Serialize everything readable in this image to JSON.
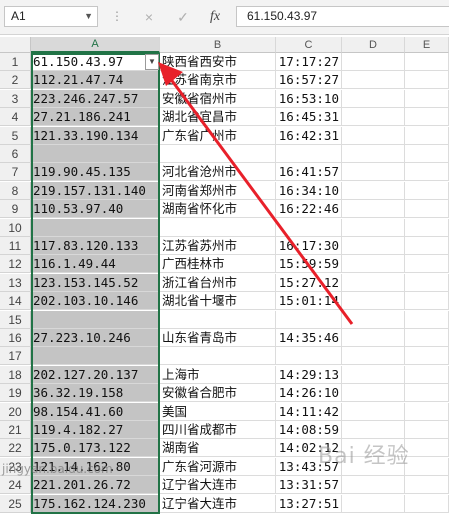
{
  "formula_bar": {
    "name_box": "A1",
    "cancel_icon": "×",
    "enter_icon": "✓",
    "fx_label": "fx",
    "content": "61.150.43.97"
  },
  "columns": [
    "A",
    "B",
    "C",
    "D",
    "E"
  ],
  "selected_column": "A",
  "rows": [
    {
      "n": "1",
      "a": "61.150.43.97",
      "b": "陕西省西安市",
      "c": "17:17:27"
    },
    {
      "n": "2",
      "a": "112.21.47.74",
      "b": "江苏省南京市",
      "c": "16:57:27"
    },
    {
      "n": "3",
      "a": "223.246.247.57",
      "b": "安徽省宿州市",
      "c": "16:53:10"
    },
    {
      "n": "4",
      "a": "27.21.186.241",
      "b": "湖北省宜昌市",
      "c": "16:45:31"
    },
    {
      "n": "5",
      "a": "121.33.190.134",
      "b": "广东省广州市",
      "c": "16:42:31"
    },
    {
      "n": "6",
      "a": "",
      "b": "",
      "c": ""
    },
    {
      "n": "7",
      "a": "119.90.45.135",
      "b": "河北省沧州市",
      "c": "16:41:57"
    },
    {
      "n": "8",
      "a": "219.157.131.140",
      "b": "河南省郑州市",
      "c": "16:34:10"
    },
    {
      "n": "9",
      "a": "110.53.97.40",
      "b": "湖南省怀化市",
      "c": "16:22:46"
    },
    {
      "n": "10",
      "a": "",
      "b": "",
      "c": ""
    },
    {
      "n": "11",
      "a": "117.83.120.133",
      "b": "江苏省苏州市",
      "c": "16:17:30"
    },
    {
      "n": "12",
      "a": "116.1.49.44",
      "b": "广西桂林市",
      "c": "15:59:59"
    },
    {
      "n": "13",
      "a": "123.153.145.52",
      "b": "浙江省台州市",
      "c": "15:27:12"
    },
    {
      "n": "14",
      "a": "202.103.10.146",
      "b": "湖北省十堰市",
      "c": "15:01:14"
    },
    {
      "n": "15",
      "a": "",
      "b": "",
      "c": ""
    },
    {
      "n": "16",
      "a": "27.223.10.246",
      "b": "山东省青岛市",
      "c": "14:35:46"
    },
    {
      "n": "17",
      "a": "",
      "b": "",
      "c": ""
    },
    {
      "n": "18",
      "a": "202.127.20.137",
      "b": "上海市",
      "c": "14:29:13"
    },
    {
      "n": "19",
      "a": "36.32.19.158",
      "b": "安徽省合肥市",
      "c": "14:26:10"
    },
    {
      "n": "20",
      "a": "98.154.41.60",
      "b": "美国",
      "c": "14:11:42"
    },
    {
      "n": "21",
      "a": "119.4.182.27",
      "b": "四川省成都市",
      "c": "14:08:59"
    },
    {
      "n": "22",
      "a": "175.0.173.122",
      "b": "湖南省",
      "c": "14:02:12"
    },
    {
      "n": "23",
      "a": "121.14.162.80",
      "b": "广东省河源市",
      "c": "13:43:57"
    },
    {
      "n": "24",
      "a": "221.201.26.72",
      "b": "辽宁省大连市",
      "c": "13:31:57"
    },
    {
      "n": "25",
      "a": "175.162.124.230",
      "b": "辽宁省大连市",
      "c": "13:27:51"
    }
  ],
  "accent_color": "#217346",
  "arrow_color": "#e8202a",
  "watermark": "Bai 经验",
  "watermark_url": "jingyan.baidu.com"
}
